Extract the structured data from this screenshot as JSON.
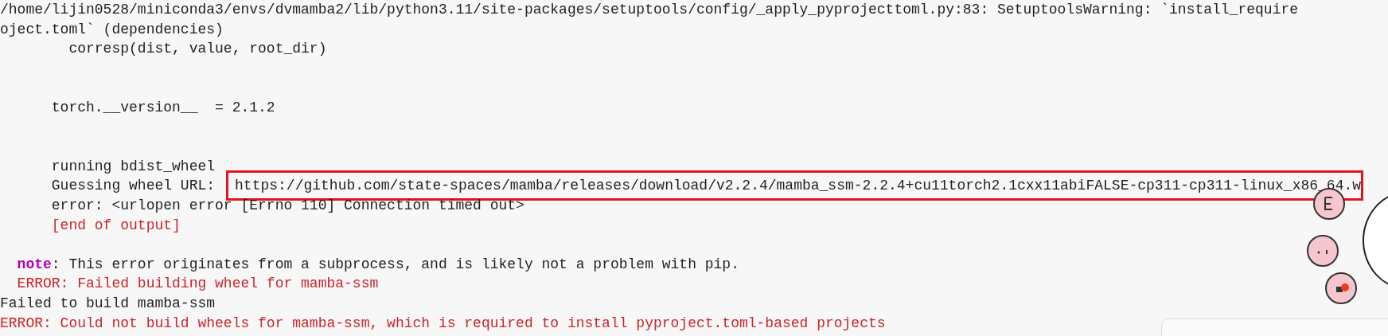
{
  "terminal": {
    "lines": [
      {
        "kind": "plain",
        "text": "/home/lijin0528/miniconda3/envs/dvmamba2/lib/python3.11/site-packages/setuptools/config/_apply_pyprojecttoml.py:83: SetuptoolsWarning: `install_require"
      },
      {
        "kind": "plain",
        "text": "oject.toml` (dependencies)"
      },
      {
        "kind": "plain",
        "text": "        corresp(dist, value, root_dir)"
      },
      {
        "kind": "blank"
      },
      {
        "kind": "blank"
      },
      {
        "kind": "plain",
        "text": "      torch.__version__  = 2.1.2"
      },
      {
        "kind": "blank"
      },
      {
        "kind": "blank"
      },
      {
        "kind": "plain",
        "text": "      running bdist_wheel"
      },
      {
        "kind": "url",
        "label": "      Guessing wheel URL:",
        "url": "https://github.com/state-spaces/mamba/releases/download/v2.2.4/mamba_ssm-2.2.4+cu11torch2.1cxx11abiFALSE-cp311-cp311-linux_x86_64.w"
      },
      {
        "kind": "plain",
        "text": "      error: <urlopen error [Errno 110] Connection timed out>"
      },
      {
        "kind": "error",
        "text": "      [end of output]"
      },
      {
        "kind": "blank"
      },
      {
        "kind": "note",
        "label": "  note",
        "text": ": This error originates from a subprocess, and is likely not a problem with pip."
      },
      {
        "kind": "error",
        "text": "  ERROR: Failed building wheel for mamba-ssm"
      },
      {
        "kind": "plain",
        "text": "Failed to build mamba-ssm"
      },
      {
        "kind": "error",
        "text": "ERROR: Could not build wheels for mamba-ssm, which is required to install pyproject.toml-based projects"
      }
    ]
  }
}
